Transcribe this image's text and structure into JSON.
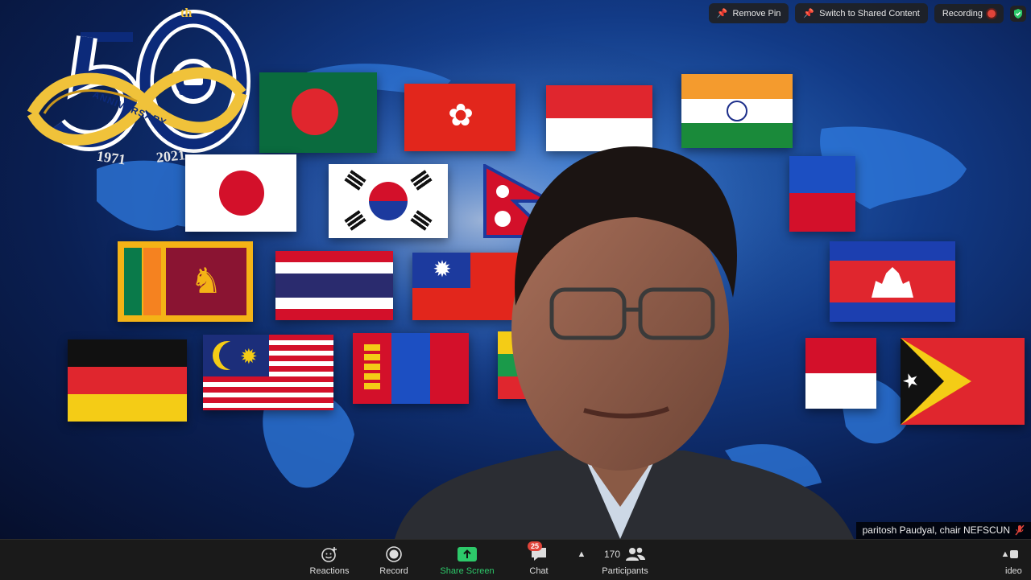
{
  "top_controls": {
    "remove_pin": "Remove Pin",
    "switch_shared": "Switch to Shared Content",
    "recording": "Recording"
  },
  "logo": {
    "numeral": "50",
    "suffix": "th",
    "ribbon": "ANNIVERSARY",
    "year_start": "1971",
    "year_end": "2021",
    "emblem": "CICC"
  },
  "speaker": {
    "name": "paritosh Paudyal, chair NEFSCUN"
  },
  "toolbar": {
    "reactions": "Reactions",
    "record": "Record",
    "share_screen": "Share Screen",
    "chat": "Chat",
    "chat_badge": "25",
    "participants": "Participants",
    "participant_count": "170",
    "video": "ideo"
  },
  "colors": {
    "share_green": "#2dc96a",
    "rec_red": "#e0443a",
    "toolbar_bg": "#1a1a1a"
  }
}
